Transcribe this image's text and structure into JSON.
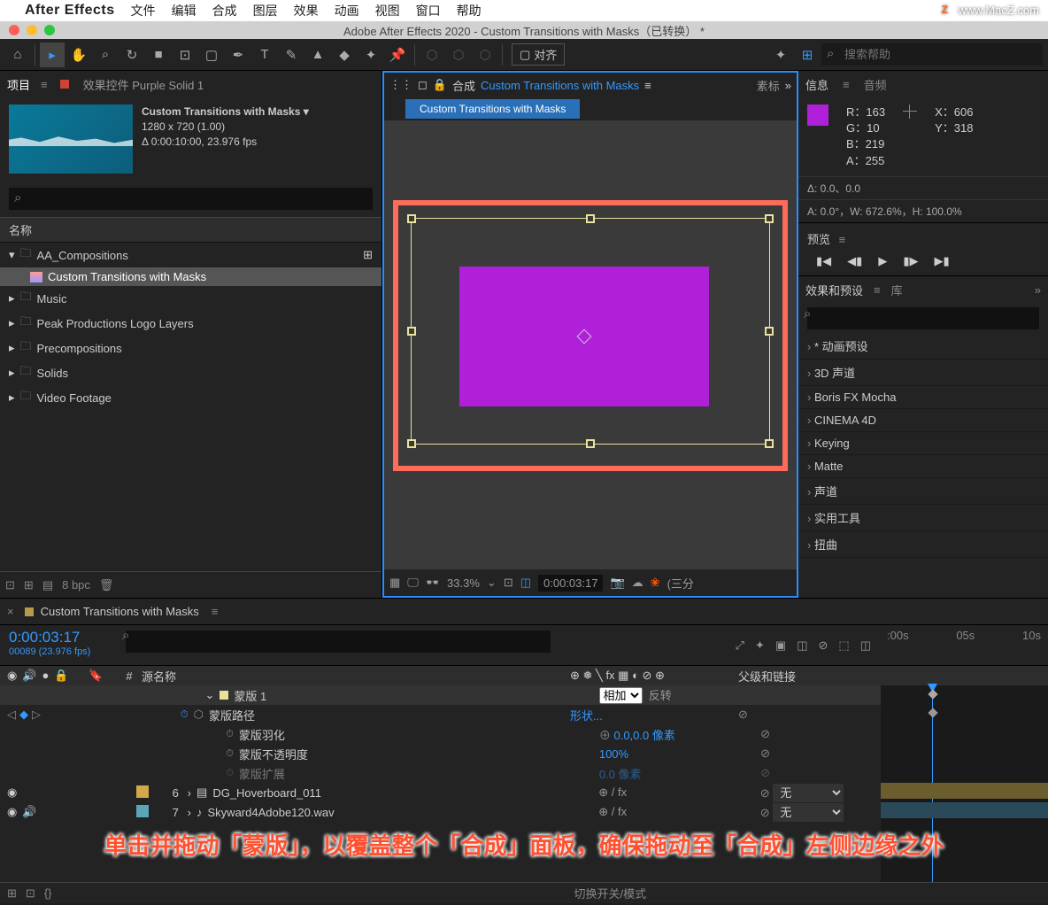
{
  "menubar": {
    "app_name": "After Effects",
    "items": [
      "文件",
      "编辑",
      "合成",
      "图层",
      "效果",
      "动画",
      "视图",
      "窗口",
      "帮助"
    ]
  },
  "watermark": "www.MacZ.com",
  "titlebar": "Adobe After Effects 2020 - Custom Transitions with Masks（已转换） *",
  "toolbar": {
    "align_label": "对齐",
    "search_placeholder": "搜索帮助"
  },
  "project": {
    "tab_project": "项目",
    "tab_effect_controls": "效果控件 Purple Solid 1",
    "comp_name": "Custom Transitions with Masks ▾",
    "resolution": "1280 x 720 (1.00)",
    "duration": "Δ 0:00:10:00, 23.976 fps",
    "col_name": "名称",
    "items": [
      {
        "type": "folder",
        "name": "AA_Compositions",
        "expanded": true
      },
      {
        "type": "comp",
        "name": "Custom Transitions with Masks",
        "selected": true,
        "indent": true
      },
      {
        "type": "folder",
        "name": "Music"
      },
      {
        "type": "folder",
        "name": "Peak Productions Logo Layers"
      },
      {
        "type": "folder",
        "name": "Precompositions"
      },
      {
        "type": "folder",
        "name": "Solids"
      },
      {
        "type": "folder",
        "name": "Video Footage"
      }
    ],
    "bpc": "8 bpc"
  },
  "composition": {
    "tab_prefix": "合成",
    "tab_name": "Custom Transitions with Masks",
    "tab_other": "素标",
    "breadcrumb": "Custom Transitions with Masks",
    "zoom": "33.3%",
    "time": "0:00:03:17",
    "res": "(三分"
  },
  "info": {
    "tab_info": "信息",
    "tab_audio": "音频",
    "r": "R：163",
    "g": "G：10",
    "b": "B：219",
    "a": "A：255",
    "x": "X：606",
    "y": "Y：318",
    "delta": "Δ: 0.0、0.0",
    "transform": "A: 0.0°，W: 672.6%，H: 100.0%"
  },
  "preview": {
    "tab": "预览"
  },
  "effects": {
    "tab_effects": "效果和预设",
    "tab_lib": "库",
    "items": [
      "* 动画预设",
      "3D 声道",
      "Boris FX Mocha",
      "CINEMA 4D",
      "Keying",
      "Matte",
      "声道",
      "实用工具",
      "扭曲"
    ]
  },
  "timeline": {
    "tab_name": "Custom Transitions with Masks",
    "timecode": "0:00:03:17",
    "frames": "00089 (23.976 fps)",
    "col_source": "源名称",
    "col_switches_sym": "⊕ ❅ ╲ fx ▦ ◐ ⊘ ⊕",
    "col_parent": "父级和链接",
    "ruler": [
      ":00s",
      "05s",
      "10s"
    ],
    "rows": [
      {
        "type": "mask",
        "name": "蒙版 1",
        "mode": "相加",
        "invert": "反转",
        "sel": true
      },
      {
        "type": "prop",
        "name": "蒙版路径",
        "value": "形状...",
        "key": true,
        "anim": true
      },
      {
        "type": "prop",
        "name": "蒙版羽化",
        "value": "0.0,0.0 像素",
        "link": "⊕"
      },
      {
        "type": "prop",
        "name": "蒙版不透明度",
        "value": "100%"
      },
      {
        "type": "prop",
        "name": "蒙版扩展",
        "value": "0.0 像素",
        "faded": true
      },
      {
        "type": "layer",
        "num": "6",
        "name": "DG_Hoverboard_011",
        "switches": "⊕ / fx",
        "parent": "无",
        "color": "#d4a74a"
      },
      {
        "type": "layer",
        "num": "7",
        "name": "Skyward4Adobe120.wav",
        "switches": "⊕ / fx",
        "parent": "无",
        "color": "#5aa5b8"
      }
    ],
    "footer_label": "切换开关/模式"
  },
  "overlay": "单击并拖动「蒙版」，以覆盖整个「合成」面板，确保拖动至「合成」左侧边缘之外"
}
